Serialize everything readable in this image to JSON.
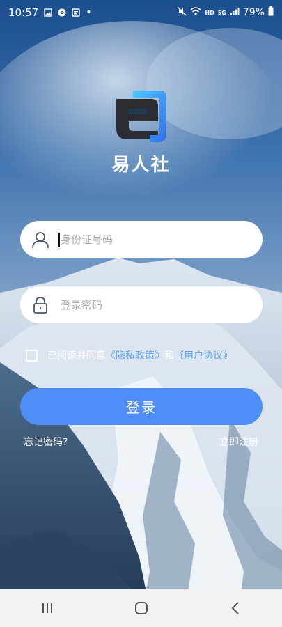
{
  "status_bar": {
    "time": "10:57",
    "dot": "•",
    "network": "5G",
    "hd": "HD",
    "battery": "79%",
    "icons": [
      "image-icon",
      "shazam-icon",
      "notification-box-icon",
      "mute-icon",
      "wifi-icon",
      "signal-icon",
      "battery-icon"
    ]
  },
  "app": {
    "name": "易人社",
    "logo": "e-logo"
  },
  "login_form": {
    "id_placeholder": "身份证号码",
    "id_value": "",
    "password_placeholder": "登录密码",
    "password_value": "",
    "agreement_prefix": "已阅读并同意",
    "privacy_link": "《隐私政策》",
    "and_text": "和",
    "user_agreement_link": "《用户协议》",
    "agreement_checked": false,
    "login_label": "登录",
    "forgot_password": "忘记密码?",
    "register": "立即注册"
  },
  "nav_bar": {
    "icons": [
      "recent-apps-icon",
      "home-icon",
      "back-icon"
    ]
  },
  "colors": {
    "accent": "#4f8ef7",
    "link": "#5ea3f0",
    "navbar": "#f2f2f2"
  }
}
